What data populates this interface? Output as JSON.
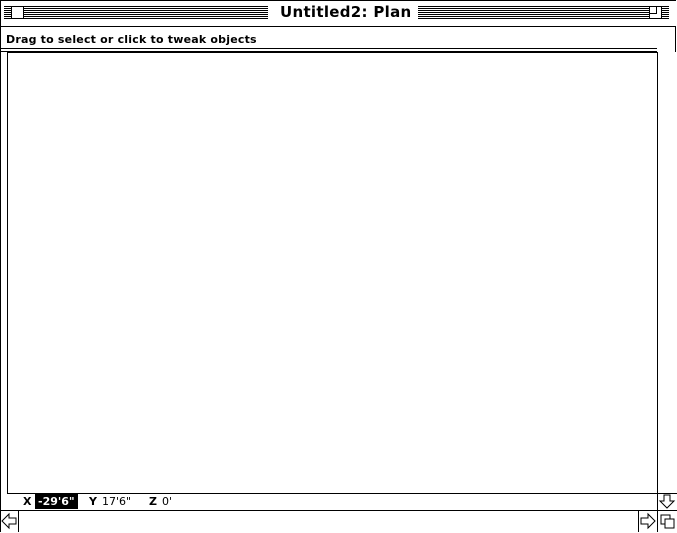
{
  "window": {
    "title": "Untitled2: Plan"
  },
  "hint": {
    "text": "Drag to select or click to tweak objects"
  },
  "coords": {
    "x_label": "X",
    "x_value": "-29'6\"",
    "y_label": "Y",
    "y_value": "17'6\"",
    "z_label": "Z",
    "z_value": "0'"
  },
  "icons": {
    "close": "close-box-icon",
    "zoom": "zoom-box-icon",
    "down": "arrow-down-icon",
    "left": "arrow-left-icon",
    "right": "arrow-right-icon",
    "grow": "grow-box-icon"
  }
}
